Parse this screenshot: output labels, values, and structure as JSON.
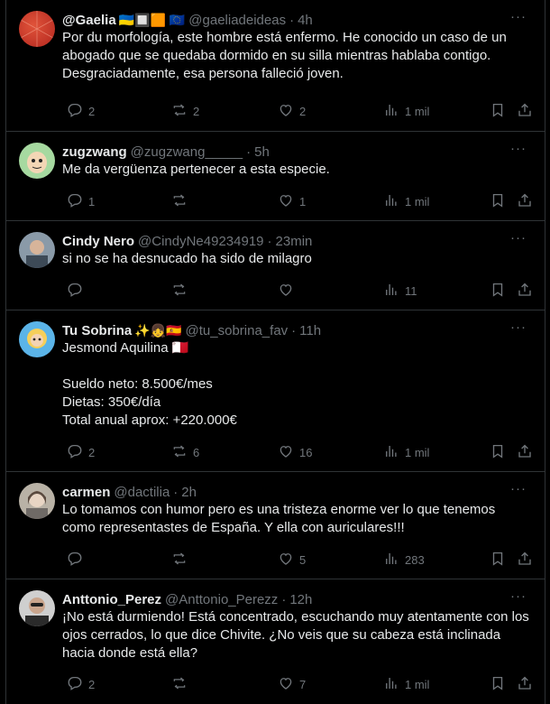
{
  "tweets": [
    {
      "name": "@Gaelia",
      "badges": "🇺🇦🔲🟧 🇪🇺",
      "handle": "@gaeliadeideas",
      "time": "4h",
      "text": "Por du morfología, este hombre está enfermo. He conocido un caso de un abogado que se quedaba dormido en su silla mientras hablaba contigo. Desgraciadamente, esa persona falleció joven.",
      "replies": "2",
      "reposts": "2",
      "likes": "2",
      "views": "1 mil"
    },
    {
      "name": "zugzwang",
      "badges": "",
      "handle": "@zugzwang_____",
      "time": "5h",
      "text": "Me da vergüenza pertenecer a esta especie.",
      "replies": "1",
      "reposts": "",
      "likes": "1",
      "views": "1 mil"
    },
    {
      "name": "Cindy Nero",
      "badges": "",
      "handle": "@CindyNe49234919",
      "time": "23min",
      "text": "si no se ha desnucado ha sido de milagro",
      "replies": "",
      "reposts": "",
      "likes": "",
      "views": "11"
    },
    {
      "name": "Tu Sobrina",
      "badges": "✨👧🇪🇸",
      "handle": "@tu_sobrina_fav",
      "time": "11h",
      "text": "Jesmond Aquilina 🇲🇹\n\nSueldo neto: 8.500€/mes\nDietas: 350€/día\nTotal anual aprox: +220.000€",
      "replies": "2",
      "reposts": "6",
      "likes": "16",
      "views": "1 mil"
    },
    {
      "name": "carmen",
      "badges": "",
      "handle": "@dactilia",
      "time": "2h",
      "text": "Lo tomamos con humor pero es una tristeza enorme ver lo que tenemos como representastes de España. Y ella con auriculares!!!",
      "replies": "",
      "reposts": "",
      "likes": "5",
      "views": "283"
    },
    {
      "name": "Anttonio_Perez",
      "badges": "",
      "handle": "@Anttonio_Perezz",
      "time": "12h",
      "text": "¡No está durmiendo! Está concentrado, escuchando muy atentamente con los ojos cerrados, lo que dice Chivite. ¿No veis que su cabeza está inclinada hacia donde está ella?",
      "replies": "2",
      "reposts": "",
      "likes": "7",
      "views": "1 mil"
    }
  ],
  "icons": {
    "reply": "reply-icon",
    "repost": "repost-icon",
    "like": "like-icon",
    "views": "views-icon",
    "bookmark": "bookmark-icon",
    "share": "share-icon",
    "more": "more-icon"
  },
  "more_glyph": "···",
  "dot": "·"
}
